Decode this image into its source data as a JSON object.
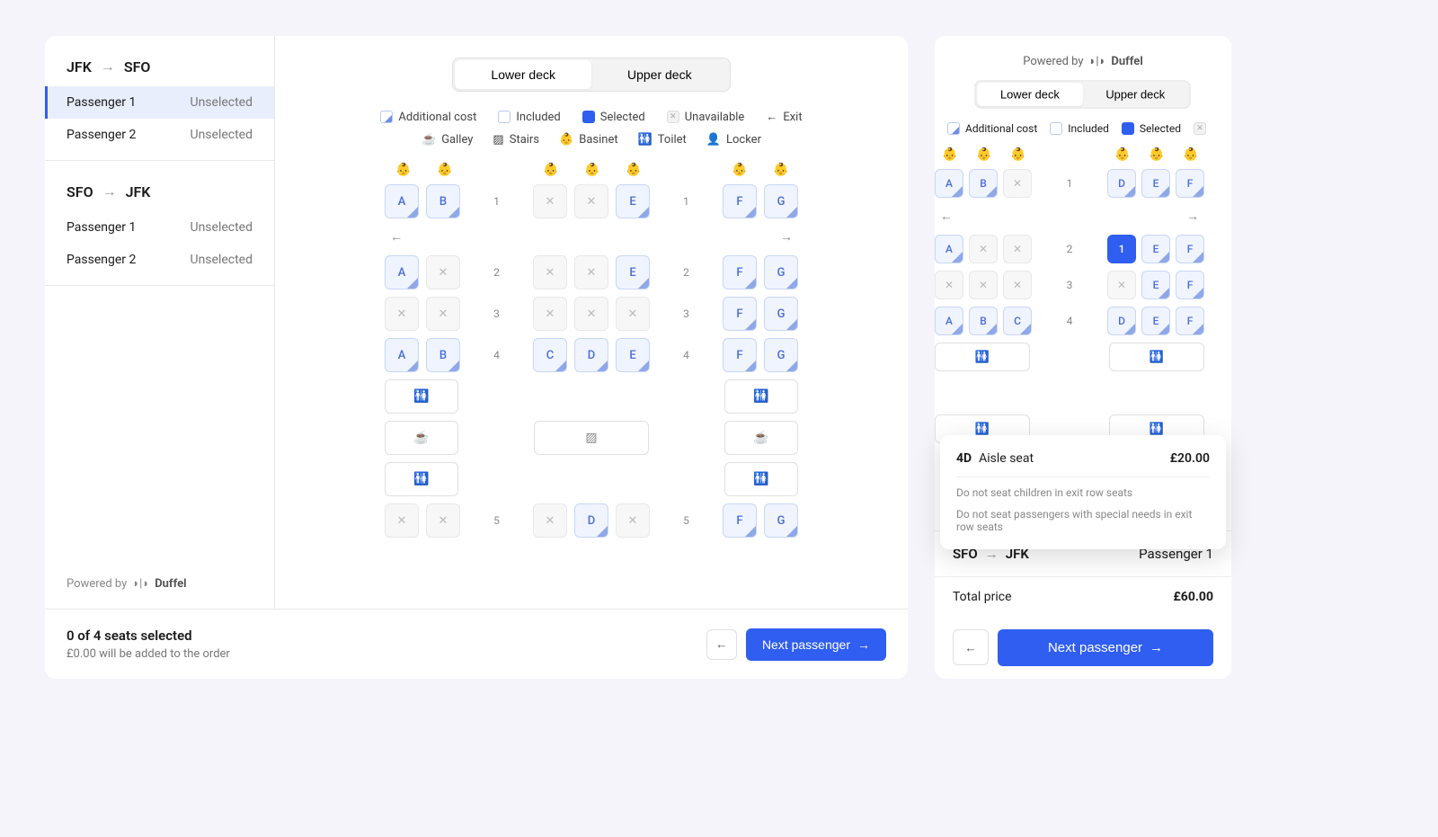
{
  "powered_by_label": "Powered by",
  "powered_by_brand": "Duffel",
  "deck": {
    "lower": "Lower deck",
    "upper": "Upper deck"
  },
  "legend": {
    "additional": "Additional cost",
    "included": "Included",
    "selected": "Selected",
    "unavailable": "Unavailable",
    "exit": "Exit",
    "galley": "Galley",
    "stairs": "Stairs",
    "basinet": "Basinet",
    "toilet": "Toilet",
    "locker": "Locker"
  },
  "sidebar": {
    "segments": [
      {
        "from": "JFK",
        "to": "SFO",
        "passengers": [
          {
            "name": "Passenger 1",
            "status": "Unselected",
            "active": true
          },
          {
            "name": "Passenger 2",
            "status": "Unselected",
            "active": false
          }
        ]
      },
      {
        "from": "SFO",
        "to": "JFK",
        "passengers": [
          {
            "name": "Passenger 1",
            "status": "Unselected",
            "active": false
          },
          {
            "name": "Passenger 2",
            "status": "Unselected",
            "active": false
          }
        ]
      }
    ]
  },
  "main_map": {
    "rows": [
      {
        "num": "1",
        "left": [
          "A",
          "B"
        ],
        "mid": [
          "x",
          "x",
          "E"
        ],
        "right": [
          "F",
          "G"
        ]
      },
      {
        "num": "2",
        "left": [
          "A",
          "x"
        ],
        "mid": [
          "x",
          "x",
          "E"
        ],
        "right": [
          "F",
          "G"
        ]
      },
      {
        "num": "3",
        "left": [
          "x",
          "x"
        ],
        "mid": [
          "x",
          "x",
          "x"
        ],
        "right": [
          "F",
          "G"
        ]
      },
      {
        "num": "4",
        "left": [
          "A",
          "B"
        ],
        "mid": [
          "C",
          "D",
          "E"
        ],
        "right": [
          "F",
          "G"
        ]
      },
      {
        "num": "5",
        "left": [
          "x",
          "x"
        ],
        "mid": [
          "x",
          "D",
          "x"
        ],
        "right": [
          "F",
          "G"
        ]
      }
    ]
  },
  "right_map": {
    "rows": [
      {
        "num": "1",
        "left": [
          "A",
          "B",
          "x"
        ],
        "right": [
          "D",
          "E",
          "F"
        ]
      },
      {
        "num": "2",
        "left": [
          "A",
          "x",
          "x"
        ],
        "right": [
          "1*",
          "E",
          "F"
        ]
      },
      {
        "num": "3",
        "left": [
          "x",
          "x",
          "x"
        ],
        "right": [
          "x",
          "E",
          "F"
        ]
      },
      {
        "num": "4",
        "left": [
          "A",
          "B",
          "C"
        ],
        "right": [
          "D",
          "E",
          "F"
        ]
      }
    ]
  },
  "footer": {
    "title": "0 of 4 seats selected",
    "sub": "£0.00 will be added to the order",
    "next": "Next passenger"
  },
  "tooltip": {
    "seat": "4D",
    "type": "Aisle seat",
    "price": "£20.00",
    "note1": "Do not seat children in exit row seats",
    "note2": "Do not seat passengers with special needs in exit row seats"
  },
  "right_footer": {
    "from": "SFO",
    "to": "JFK",
    "passenger": "Passenger 1",
    "total_label": "Total price",
    "total": "£60.00",
    "next": "Next passenger"
  }
}
